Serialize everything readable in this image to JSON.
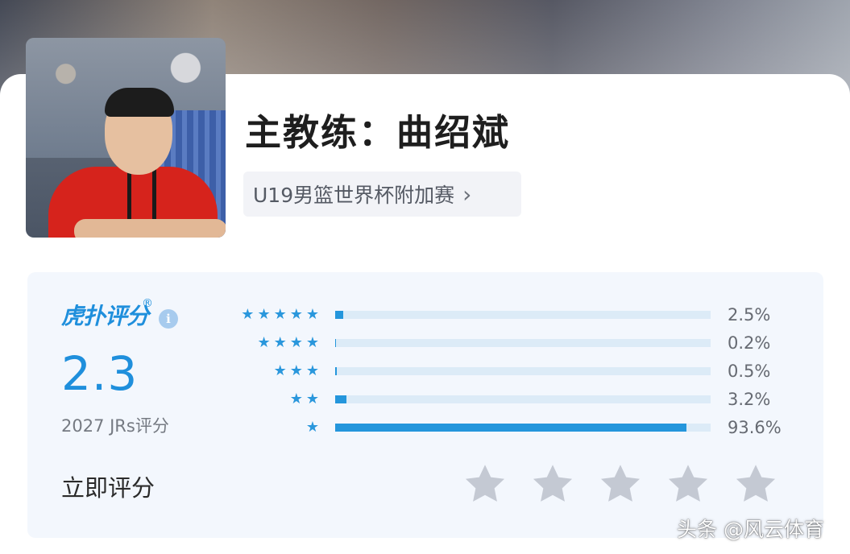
{
  "coach": {
    "title": "主教练：曲绍斌",
    "event_label": "U19男篮世界杯附加赛",
    "event_chevron": "chevron-right-icon"
  },
  "rating": {
    "brand": "虎扑评分",
    "brand_mark": "®",
    "info_icon": "info-icon",
    "score": "2.3",
    "count_text": "2027 JRs评分",
    "accent_color": "#1f8fdc",
    "distribution": [
      {
        "stars": 5,
        "percent_label": "2.5%",
        "fraction": 0.025
      },
      {
        "stars": 4,
        "percent_label": "0.2%",
        "fraction": 0.002
      },
      {
        "stars": 3,
        "percent_label": "0.5%",
        "fraction": 0.005
      },
      {
        "stars": 2,
        "percent_label": "3.2%",
        "fraction": 0.032
      },
      {
        "stars": 1,
        "percent_label": "93.6%",
        "fraction": 0.936
      }
    ],
    "rate_now_label": "立即评分",
    "rate_star_count": 5,
    "rate_star_color": "#c4c9d3"
  },
  "watermark": "头条 @风云体育"
}
